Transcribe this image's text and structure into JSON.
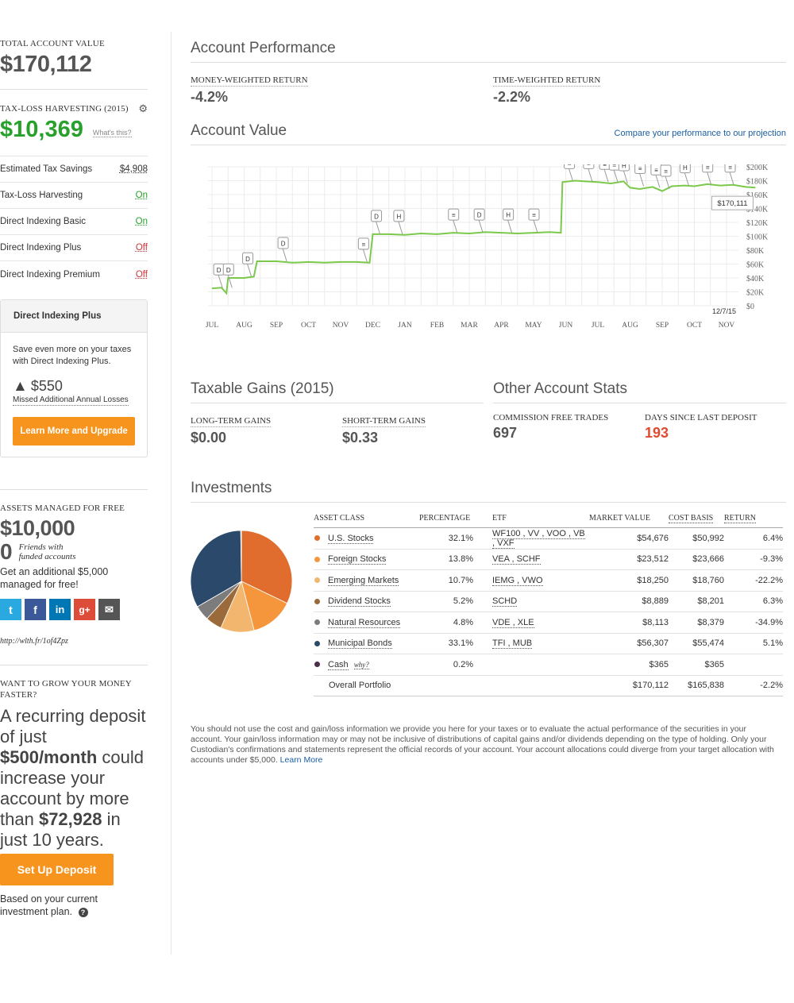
{
  "sidebar": {
    "total_label": "TOTAL ACCOUNT VALUE",
    "total_value": "$170,112",
    "tlh_label": "TAX-LOSS HARVESTING (2015)",
    "tlh_value": "$10,369",
    "whats_this": "What's this?",
    "settings": [
      {
        "label": "Estimated Tax Savings",
        "value": "$4,908",
        "status": "neutral"
      },
      {
        "label": "Tax-Loss Harvesting",
        "value": "On",
        "status": "on"
      },
      {
        "label": "Direct Indexing Basic",
        "value": "On",
        "status": "on"
      },
      {
        "label": "Direct Indexing Plus",
        "value": "Off",
        "status": "off"
      },
      {
        "label": "Direct Indexing Premium",
        "value": "Off",
        "status": "off"
      }
    ],
    "upgrade": {
      "title": "Direct Indexing Plus",
      "text": "Save even more on your taxes with Direct Indexing Plus.",
      "amount": "$550",
      "amount_caption": "Missed Additional Annual Losses",
      "button": "Learn More and Upgrade"
    },
    "referral": {
      "label": "ASSETS MANAGED FOR FREE",
      "value": "$10,000",
      "friends_count": "0",
      "friends_text_1": "Friends with",
      "friends_text_2": "funded accounts",
      "offer": "Get an additional $5,000 managed for free!",
      "social_icons": [
        "twitter-icon",
        "facebook-icon",
        "linkedin-icon",
        "google-plus-icon",
        "email-icon"
      ],
      "social_glyphs": [
        "t",
        "f",
        "in",
        "g+",
        "✉"
      ],
      "social_colors": [
        "#2aa9e0",
        "#3b5998",
        "#0077b5",
        "#dd4b39",
        "#555555"
      ],
      "link": "http://wlth.fr/1of4Zpz"
    },
    "deposit": {
      "label": "WANT TO GROW YOUR MONEY FASTER?",
      "text_1": "A recurring deposit of just",
      "amount": "$500/month",
      "text_2": "could increase your account by more than",
      "increase": "$72,928",
      "text_3": "in just 10 years.",
      "button": "Set Up Deposit",
      "footnote": "Based on your current investment plan."
    }
  },
  "performance": {
    "title": "Account Performance",
    "mwr_label": "MONEY-WEIGHTED RETURN",
    "mwr_value": "-4.2%",
    "twr_label": "TIME-WEIGHTED RETURN",
    "twr_value": "-2.2%"
  },
  "account_value": {
    "title": "Account Value",
    "compare_link": "Compare your performance to our projection"
  },
  "chart_data": {
    "type": "line",
    "x_labels": [
      "JUL",
      "AUG",
      "SEP",
      "OCT",
      "NOV",
      "DEC",
      "JAN",
      "FEB",
      "MAR",
      "APR",
      "MAY",
      "JUN",
      "JUL",
      "AUG",
      "SEP",
      "OCT",
      "NOV"
    ],
    "y_labels": [
      "$200K",
      "$180K",
      "$160K",
      "$140K",
      "$120K",
      "$100K",
      "$80K",
      "$60K",
      "$40K",
      "$20K",
      "$0"
    ],
    "ylim": [
      0,
      200000
    ],
    "line_color": "#7bc94b",
    "tooltip": "$170,111",
    "end_date": "12/7/15",
    "points": [
      [
        0.0,
        25000
      ],
      [
        0.3,
        26000
      ],
      [
        0.45,
        18000
      ],
      [
        0.5,
        40000
      ],
      [
        1.0,
        40000
      ],
      [
        1.3,
        42000
      ],
      [
        1.4,
        64000
      ],
      [
        2.0,
        64000
      ],
      [
        2.5,
        62000
      ],
      [
        3.0,
        63000
      ],
      [
        3.5,
        62000
      ],
      [
        4.0,
        63000
      ],
      [
        4.5,
        63000
      ],
      [
        4.9,
        62000
      ],
      [
        5.0,
        103000
      ],
      [
        5.5,
        103000
      ],
      [
        6.0,
        102000
      ],
      [
        6.5,
        104000
      ],
      [
        7.0,
        103000
      ],
      [
        7.5,
        105000
      ],
      [
        8.0,
        104000
      ],
      [
        8.5,
        106000
      ],
      [
        9.0,
        105000
      ],
      [
        9.5,
        104000
      ],
      [
        10.0,
        105000
      ],
      [
        10.5,
        106000
      ],
      [
        10.85,
        105000
      ],
      [
        10.9,
        178000
      ],
      [
        11.3,
        180000
      ],
      [
        11.6,
        179000
      ],
      [
        12.0,
        178000
      ],
      [
        12.4,
        176000
      ],
      [
        12.8,
        179000
      ],
      [
        13.0,
        170000
      ],
      [
        13.3,
        168000
      ],
      [
        13.7,
        171000
      ],
      [
        14.0,
        165000
      ],
      [
        14.3,
        172000
      ],
      [
        14.7,
        173000
      ],
      [
        15.0,
        172000
      ],
      [
        15.4,
        175000
      ],
      [
        15.8,
        173000
      ],
      [
        16.2,
        174000
      ],
      [
        16.6,
        171000
      ],
      [
        16.9,
        170111
      ]
    ],
    "markers": [
      {
        "label": "D",
        "x": 0.2,
        "y": 26000
      },
      {
        "label": "D",
        "x": 0.5,
        "y": 26000
      },
      {
        "label": "D",
        "x": 1.1,
        "y": 42000
      },
      {
        "label": "D",
        "x": 2.2,
        "y": 64000
      },
      {
        "label": "≡",
        "x": 4.7,
        "y": 63000
      },
      {
        "label": "D",
        "x": 5.1,
        "y": 103000
      },
      {
        "label": "H",
        "x": 5.8,
        "y": 103000
      },
      {
        "label": "≡",
        "x": 7.5,
        "y": 105000
      },
      {
        "label": "D",
        "x": 8.3,
        "y": 105000
      },
      {
        "label": "H",
        "x": 9.2,
        "y": 105000
      },
      {
        "label": "≡",
        "x": 10.0,
        "y": 105000
      },
      {
        "label": "≡",
        "x": 11.1,
        "y": 179000
      },
      {
        "label": "≡",
        "x": 11.7,
        "y": 179000
      },
      {
        "label": "≡",
        "x": 12.2,
        "y": 178000
      },
      {
        "label": "≡",
        "x": 12.5,
        "y": 177000
      },
      {
        "label": "H",
        "x": 12.8,
        "y": 176000
      },
      {
        "label": "≡",
        "x": 13.3,
        "y": 172000
      },
      {
        "label": "≡",
        "x": 13.8,
        "y": 170000
      },
      {
        "label": "≡",
        "x": 14.1,
        "y": 168000
      },
      {
        "label": "H",
        "x": 14.7,
        "y": 173000
      },
      {
        "label": "≡",
        "x": 15.4,
        "y": 174000
      },
      {
        "label": "≡",
        "x": 16.1,
        "y": 174000
      }
    ]
  },
  "taxable": {
    "title": "Taxable Gains (2015)",
    "lt_label": "LONG-TERM GAINS",
    "lt_value": "$0.00",
    "st_label": "SHORT-TERM GAINS",
    "st_value": "$0.33"
  },
  "stats": {
    "title": "Other Account Stats",
    "cft_label": "COMMISSION FREE TRADES",
    "cft_value": "697",
    "days_label": "DAYS SINCE LAST DEPOSIT",
    "days_value": "193"
  },
  "investments": {
    "title": "Investments",
    "headers": {
      "asset": "ASSET CLASS",
      "pct": "PERCENTAGE",
      "etf": "ETF",
      "mv": "MARKET VALUE",
      "cb": "COST BASIS",
      "ret": "RETURN"
    },
    "rows": [
      {
        "asset": "U.S. Stocks",
        "pct": "32.1%",
        "etf": "WF100 , VV , VOO , VB , VXF",
        "mv": "$54,676",
        "cb": "$50,992",
        "ret": "6.4%",
        "ret_positive": true,
        "color": "#e06d2e",
        "share": 32.1
      },
      {
        "asset": "Foreign Stocks",
        "pct": "13.8%",
        "etf": "VEA , SCHF",
        "mv": "$23,512",
        "cb": "$23,666",
        "ret": "-9.3%",
        "ret_positive": false,
        "color": "#f5963c",
        "share": 13.8
      },
      {
        "asset": "Emerging Markets",
        "pct": "10.7%",
        "etf": "IEMG , VWO",
        "mv": "$18,250",
        "cb": "$18,760",
        "ret": "-22.2%",
        "ret_positive": false,
        "color": "#f2b66e",
        "share": 10.7
      },
      {
        "asset": "Dividend Stocks",
        "pct": "5.2%",
        "etf": "SCHD",
        "mv": "$8,889",
        "cb": "$8,201",
        "ret": "6.3%",
        "ret_positive": true,
        "color": "#9a6a3a",
        "share": 5.2
      },
      {
        "asset": "Natural Resources",
        "pct": "4.8%",
        "etf": "VDE , XLE",
        "mv": "$8,113",
        "cb": "$8,379",
        "ret": "-34.9%",
        "ret_positive": false,
        "color": "#7c7c7c",
        "share": 4.8
      },
      {
        "asset": "Municipal Bonds",
        "pct": "33.1%",
        "etf": "TFI , MUB",
        "mv": "$56,307",
        "cb": "$55,474",
        "ret": "5.1%",
        "ret_positive": true,
        "color": "#2b4a6b",
        "share": 33.1
      },
      {
        "asset": "Cash",
        "why": "why?",
        "pct": "0.2%",
        "etf": "",
        "mv": "$365",
        "cb": "$365",
        "ret": "",
        "ret_positive": true,
        "color": "#4a2e4a",
        "share": 0.2
      }
    ],
    "total": {
      "asset": "Overall Portfolio",
      "mv": "$170,112",
      "cb": "$165,838",
      "ret": "-2.2%"
    }
  },
  "disclaimer": {
    "text": "You should not use the cost and gain/loss information we provide you here for your taxes or to evaluate the actual performance of the securities in your account. Your gain/loss information may or may not be inclusive of distributions of capital gains and/or dividends depending on the type of holding. Only your Custodian's confirmations and statements represent the official records of your account. Your account allocations could diverge from your target allocation with accounts under $5,000.",
    "link": "Learn More"
  }
}
